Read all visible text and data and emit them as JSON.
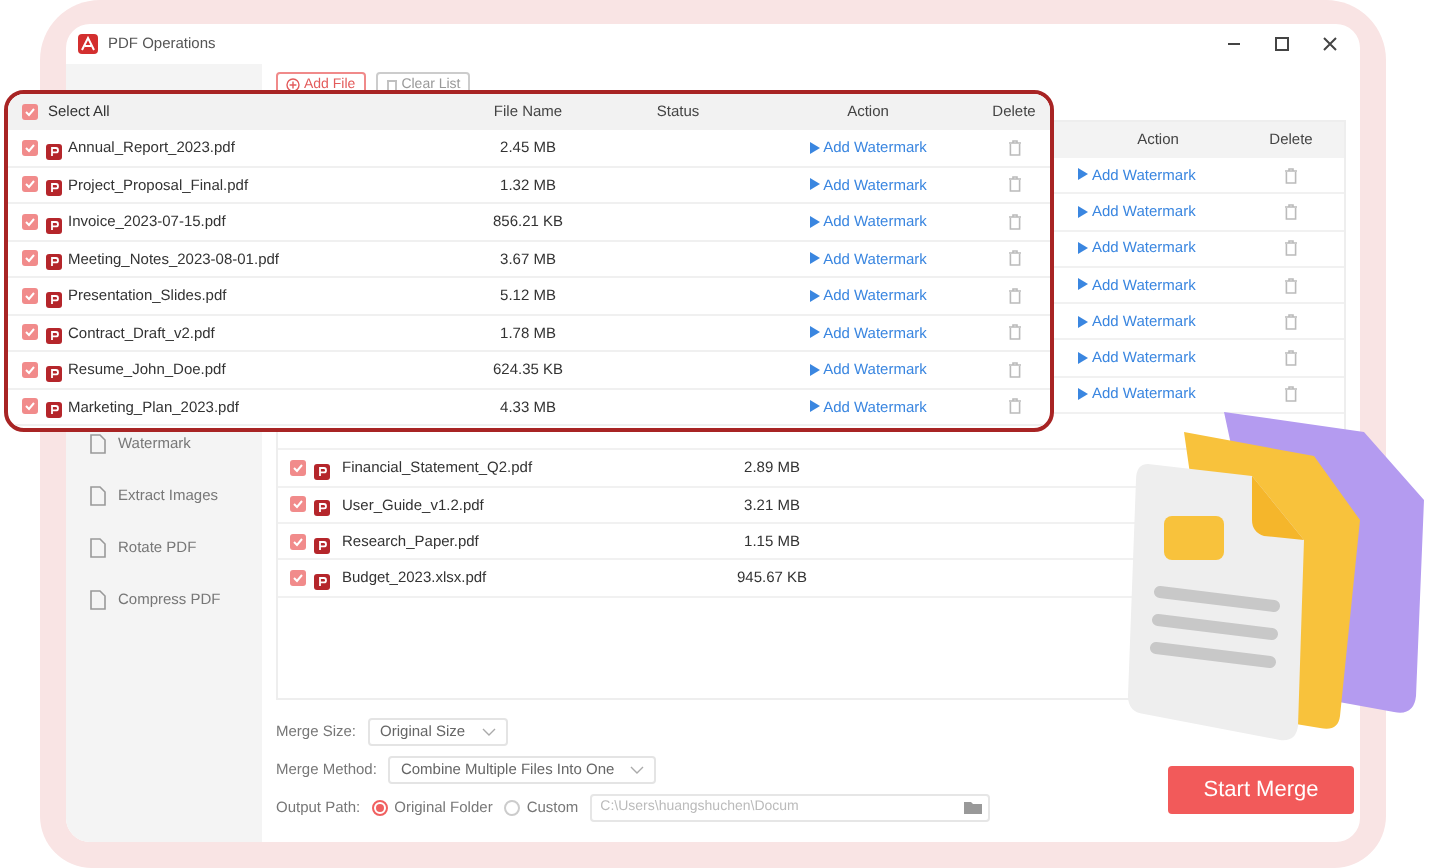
{
  "window": {
    "title": "PDF Operations"
  },
  "sidebar": {
    "items": [
      {
        "label": "Watermark"
      },
      {
        "label": "Extract Images"
      },
      {
        "label": "Rotate PDF"
      },
      {
        "label": "Compress PDF"
      }
    ]
  },
  "toolbar": {
    "buttons": [
      {
        "label": "Add File",
        "kind": "primary"
      },
      {
        "label": "Clear List",
        "kind": "secondary"
      }
    ]
  },
  "file_table": {
    "columns": [
      "Action",
      "Delete"
    ],
    "rows": [
      {
        "action": "Add Watermark"
      },
      {
        "action": "Add Watermark"
      },
      {
        "action": "Add Watermark"
      },
      {
        "action": "Add Watermark"
      },
      {
        "action": "Add Watermark"
      },
      {
        "action": "Add Watermark"
      },
      {
        "action": "Add Watermark"
      },
      {
        "name": "Financial_Statement_Q2.pdf",
        "size": "2.89 MB",
        "checked": true
      },
      {
        "name": "User_Guide_v1.2.pdf",
        "size": "3.21 MB",
        "checked": true
      },
      {
        "name": "Research_Paper.pdf",
        "size": "1.15 MB",
        "checked": true
      },
      {
        "name": "Budget_2023.xlsx.pdf",
        "size": "945.67 KB",
        "checked": true
      }
    ]
  },
  "zoom_panel": {
    "select_all": {
      "label": "Select All",
      "checked": true
    },
    "columns": [
      "File Name",
      "Status",
      "Action",
      "Delete"
    ],
    "rows": [
      {
        "name": "Annual_Report_2023.pdf",
        "size": "2.45 MB",
        "checked": true,
        "action": "Add Watermark"
      },
      {
        "name": "Project_Proposal_Final.pdf",
        "size": "1.32 MB",
        "checked": true,
        "action": "Add Watermark"
      },
      {
        "name": "Invoice_2023-07-15.pdf",
        "size": "856.21 KB",
        "checked": true,
        "action": "Add Watermark"
      },
      {
        "name": "Meeting_Notes_2023-08-01.pdf",
        "size": "3.67 MB",
        "checked": true,
        "action": "Add Watermark"
      },
      {
        "name": "Presentation_Slides.pdf",
        "size": "5.12 MB",
        "checked": true,
        "action": "Add Watermark"
      },
      {
        "name": "Contract_Draft_v2.pdf",
        "size": "1.78 MB",
        "checked": true,
        "action": "Add Watermark"
      },
      {
        "name": "Resume_John_Doe.pdf",
        "size": "624.35 KB",
        "checked": true,
        "action": "Add Watermark"
      },
      {
        "name": "Marketing_Plan_2023.pdf",
        "size": "4.33 MB",
        "checked": true,
        "action": "Add Watermark"
      }
    ]
  },
  "options": {
    "merge_size": {
      "label": "Merge Size:",
      "value": "Original Size"
    },
    "merge_method": {
      "label": "Merge Method:",
      "value": "Combine Multiple Files Into One"
    },
    "output_path": {
      "label": "Output Path:",
      "options": [
        {
          "label": "Original Folder",
          "selected": true
        },
        {
          "label": "Custom",
          "selected": false
        }
      ],
      "placeholder": "C:\\Users\\huangshuchen\\Docum"
    }
  },
  "start_button": {
    "label": "Start Merge"
  }
}
